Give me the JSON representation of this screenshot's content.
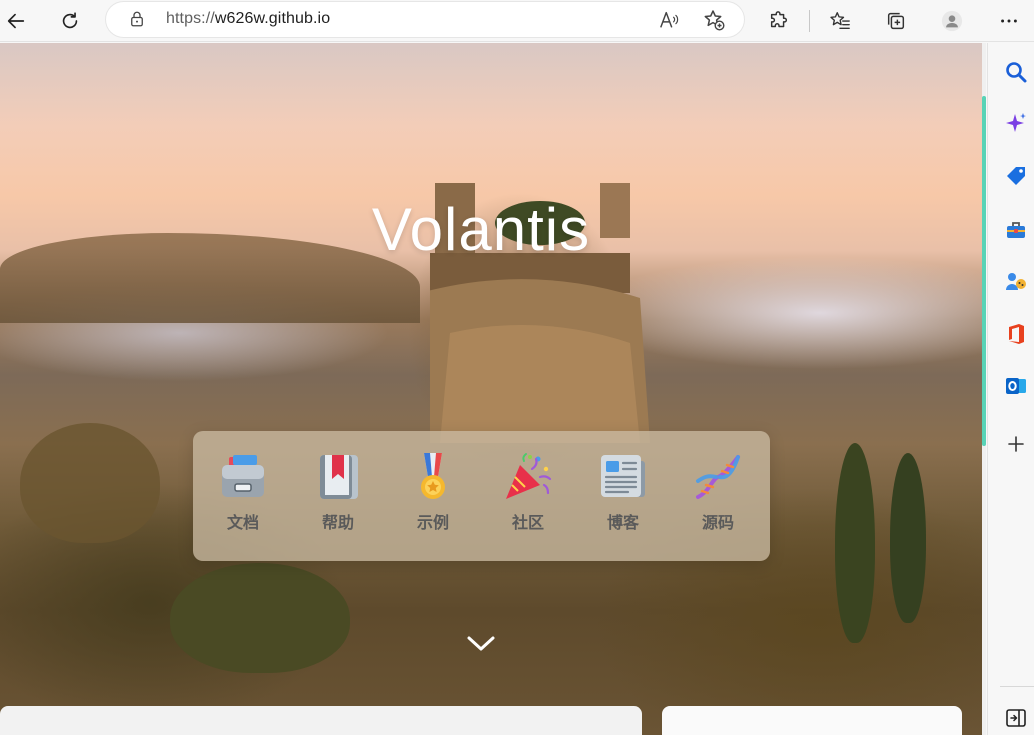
{
  "browser": {
    "url_scheme": "https://",
    "url_host": "w626w.github.io"
  },
  "page": {
    "title": "Volantis",
    "menu": [
      {
        "label": "文档",
        "icon": "file-cabinet-icon"
      },
      {
        "label": "帮助",
        "icon": "book-icon"
      },
      {
        "label": "示例",
        "icon": "medal-icon"
      },
      {
        "label": "社区",
        "icon": "party-popper-icon"
      },
      {
        "label": "博客",
        "icon": "newspaper-icon"
      },
      {
        "label": "源码",
        "icon": "dna-icon"
      }
    ]
  },
  "colors": {
    "scroll_accent": "#58d3b6",
    "title_color": "#ffffff"
  }
}
